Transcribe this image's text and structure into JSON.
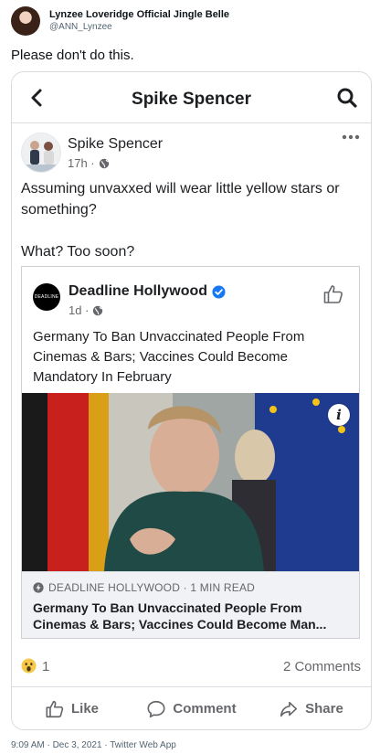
{
  "tweet": {
    "author_name": "Lynzee Loveridge Official Jingle Belle",
    "author_handle": "@ANN_Lynzee",
    "text": "Please don't do this.",
    "footer": "9:09 AM · Dec 3, 2021 · Twitter Web App"
  },
  "fb_nav": {
    "title": "Spike Spencer",
    "back_icon": "chevron-left-icon",
    "search_icon": "search-icon"
  },
  "post": {
    "author": "Spike Spencer",
    "time": "17h ·",
    "text_line1": "Assuming unvaxxed will wear little yellow stars or something?",
    "text_line2": "What? Too soon?"
  },
  "shared_post": {
    "page_name": "Deadline Hollywood",
    "avatar_text": "DEADLINE",
    "time": "1d ·",
    "text": "Germany To Ban Unvaccinated People From Cinemas & Bars; Vaccines Could Become Mandatory In February",
    "link_source": "DEADLINE HOLLYWOOD · 1 MIN READ",
    "link_title": "Germany To Ban Unvaccinated People From Cinemas & Bars; Vaccines Could Become Man..."
  },
  "engagement": {
    "reaction_count": "1",
    "comments": "2 Comments"
  },
  "actions": {
    "like": "Like",
    "comment": "Comment",
    "share": "Share"
  },
  "colors": {
    "facebook_blue": "#1877f2",
    "text_secondary": "#65676b",
    "link_card_bg": "#f0f2f5"
  }
}
